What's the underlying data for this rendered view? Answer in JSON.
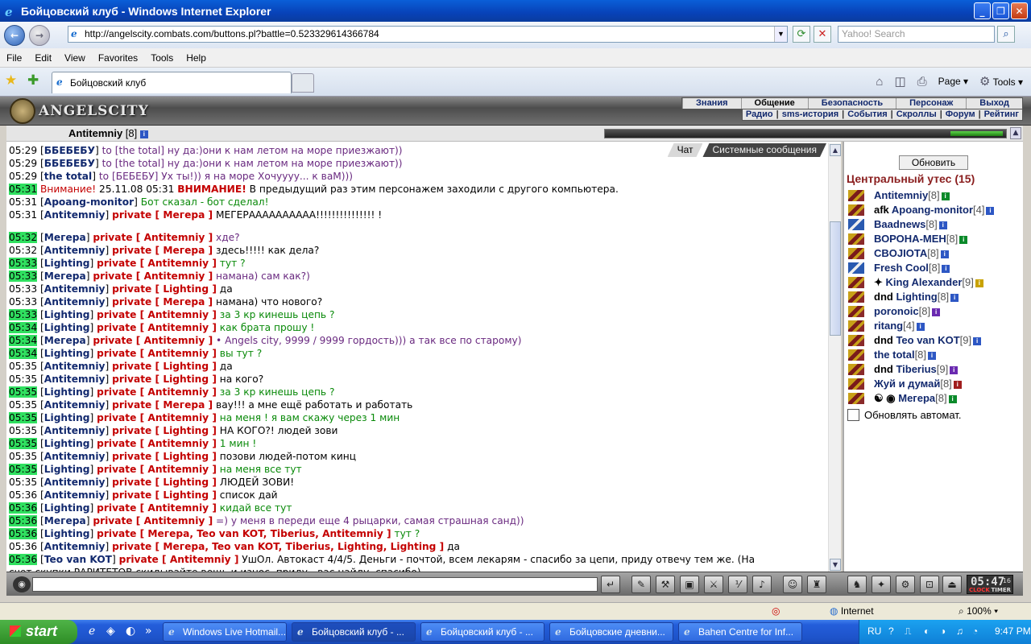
{
  "window": {
    "title": "Бойцовский клуб - Windows Internet Explorer"
  },
  "address": {
    "url": "http://angelscity.combats.com/buttons.pl?battle=0.523329614366784",
    "search_placeholder": "Yahoo! Search"
  },
  "menu": [
    "File",
    "Edit",
    "View",
    "Favorites",
    "Tools",
    "Help"
  ],
  "tab": {
    "title": "Бойцовский клуб"
  },
  "commands": {
    "page": "Page",
    "tools": "Tools"
  },
  "game": {
    "logo": "ANGELSCITY",
    "nav_top": [
      "Знания",
      "Общение",
      "Безопасность",
      "Персонаж",
      "Выход"
    ],
    "nav_bottom": [
      "Радио",
      "sms-история",
      "События",
      "Скроллы",
      "Форум",
      "Рейтинг"
    ],
    "user": {
      "name": "Antitemniy",
      "level": "[8]"
    },
    "hp_fraction": 0.13
  },
  "chat": {
    "tabs": [
      "Чат",
      "Системные сообщения"
    ],
    "lines": [
      {
        "time": "05:29",
        "hl": false,
        "name": "ББЕБЕБУ",
        "pre": " to [the total] ",
        "priv": "",
        "msg": "ну да:)они к нам летом на море приезжают))",
        "color": "purple"
      },
      {
        "time": "05:29",
        "hl": false,
        "name": "ББЕБЕБУ",
        "pre": " to [the total] ",
        "priv": "",
        "msg": "ну да:)они к нам летом на море приезжают))",
        "color": "purple"
      },
      {
        "time": "05:29",
        "hl": false,
        "name": "the total",
        "pre": " to [БЕБЕБУ] ",
        "priv": "",
        "msg": "Ух ты!)) я на море Хочуууу... к ваМ)))",
        "color": "purple"
      },
      {
        "time": "05:31",
        "hl": true,
        "name": "",
        "pre": "",
        "priv": "",
        "msg": "",
        "color": "black",
        "warning": {
          "label": "Внимание!",
          "date": " 25.11.08 05:31 ",
          "bold": "ВНИМАНИЕ!",
          "text": " В предыдущий раз этим персонажем заходили с другого компьютера."
        }
      },
      {
        "time": "05:31",
        "hl": false,
        "name": "Apoang-monitor",
        "pre": " ",
        "priv": "",
        "msg": "Бот сказал - бот сделал!",
        "color": "green"
      },
      {
        "time": "05:31",
        "hl": false,
        "name": "Antitemniy",
        "pre": " ",
        "priv": "private [ Мегера ]",
        "msg": " МЕГЕРАААААААААА!!!!!!!!!!!!!!! !",
        "color": "black"
      },
      {
        "time": "05:32",
        "hl": true,
        "gap": true,
        "name": "Мегера",
        "pre": " ",
        "priv": "private [ Antitemniy ]",
        "msg": "        хде?",
        "color": "purple"
      },
      {
        "time": "05:32",
        "hl": false,
        "name": "Antitemniy",
        "pre": " ",
        "priv": "private [ Мегера ]",
        "msg": " здесь!!!!! как дела?",
        "color": "black"
      },
      {
        "time": "05:33",
        "hl": true,
        "name": "Lighting",
        "pre": " ",
        "priv": "private [ Antitemniy ]",
        "msg": " тут ?",
        "color": "green"
      },
      {
        "time": "05:33",
        "hl": true,
        "name": "Мегера",
        "pre": " ",
        "priv": "private [ Antitemniy ]",
        "msg": " намана) сам как?)",
        "color": "purple"
      },
      {
        "time": "05:33",
        "hl": false,
        "name": "Antitemniy",
        "pre": " ",
        "priv": "private [ Lighting ]",
        "msg": " да",
        "color": "black"
      },
      {
        "time": "05:33",
        "hl": false,
        "name": "Antitemniy",
        "pre": " ",
        "priv": "private [ Мегера ]",
        "msg": " намана) что нового?",
        "color": "black"
      },
      {
        "time": "05:33",
        "hl": true,
        "name": "Lighting",
        "pre": " ",
        "priv": "private [ Antitemniy ]",
        "msg": " за 3 кр кинешь цепь ?",
        "color": "green"
      },
      {
        "time": "05:34",
        "hl": true,
        "name": "Lighting",
        "pre": " ",
        "priv": "private [ Antitemniy ]",
        "msg": " как брата прошу !",
        "color": "green"
      },
      {
        "time": "05:34",
        "hl": true,
        "name": "Мегера",
        "pre": " ",
        "priv": "private [ Antitemniy ]",
        "msg": " • Angels city, 9999 / 9999 гордость))) а так все по старому)",
        "color": "purple"
      },
      {
        "time": "05:34",
        "hl": true,
        "name": "Lighting",
        "pre": " ",
        "priv": "private [ Antitemniy ]",
        "msg": " вы тут ?",
        "color": "green"
      },
      {
        "time": "05:35",
        "hl": false,
        "name": "Antitemniy",
        "pre": " ",
        "priv": "private [ Lighting ]",
        "msg": " да",
        "color": "black"
      },
      {
        "time": "05:35",
        "hl": false,
        "name": "Antitemniy",
        "pre": " ",
        "priv": "private [ Lighting ]",
        "msg": " на кого?",
        "color": "black"
      },
      {
        "time": "05:35",
        "hl": true,
        "name": "Lighting",
        "pre": " ",
        "priv": "private [ Antitemniy ]",
        "msg": " за 3 кр кинешь цепь ?",
        "color": "green"
      },
      {
        "time": "05:35",
        "hl": false,
        "name": "Antitemniy",
        "pre": " ",
        "priv": "private [ Мегера ]",
        "msg": " вау!!! а мне ещё работать и работать",
        "color": "black"
      },
      {
        "time": "05:35",
        "hl": true,
        "name": "Lighting",
        "pre": " ",
        "priv": "private [ Antitemniy ]",
        "msg": " на меня ! я вам скажу через 1 мин",
        "color": "green"
      },
      {
        "time": "05:35",
        "hl": false,
        "name": "Antitemniy",
        "pre": " ",
        "priv": "private [ Lighting ]",
        "msg": " НА КОГО?! людей зови",
        "color": "black"
      },
      {
        "time": "05:35",
        "hl": true,
        "name": "Lighting",
        "pre": " ",
        "priv": "private [ Antitemniy ]",
        "msg": " 1 мин !",
        "color": "green"
      },
      {
        "time": "05:35",
        "hl": false,
        "name": "Antitemniy",
        "pre": " ",
        "priv": "private [ Lighting ]",
        "msg": " позови людей-потом кинц",
        "color": "black"
      },
      {
        "time": "05:35",
        "hl": true,
        "name": "Lighting",
        "pre": " ",
        "priv": "private [ Antitemniy ]",
        "msg": " на меня все тут",
        "color": "green"
      },
      {
        "time": "05:35",
        "hl": false,
        "name": "Antitemniy",
        "pre": " ",
        "priv": "private [ Lighting ]",
        "msg": " ЛЮДЕЙ ЗОВИ!",
        "color": "black"
      },
      {
        "time": "05:36",
        "hl": false,
        "name": "Antitemniy",
        "pre": " ",
        "priv": "private [ Lighting ]",
        "msg": " список дай",
        "color": "black"
      },
      {
        "time": "05:36",
        "hl": true,
        "name": "Lighting",
        "pre": " ",
        "priv": "private [ Antitemniy ]",
        "msg": " кидай все тут",
        "color": "green"
      },
      {
        "time": "05:36",
        "hl": true,
        "name": "Мегера",
        "pre": " ",
        "priv": "private [ Antitemniy ]",
        "msg": " =) у меня в переди еще 4 рыцарки, самая страшная санд))",
        "color": "purple"
      },
      {
        "time": "05:36",
        "hl": true,
        "name": "Lighting",
        "pre": " ",
        "priv": "private [ Мегера, Teo van KOT, Tiberius, Antitemniy ]",
        "msg": " тут ?",
        "color": "green"
      },
      {
        "time": "05:36",
        "hl": false,
        "name": "Antitemniy",
        "pre": " ",
        "priv": "private [ Мегера, Teo van KOT, Tiberius, Lighting, Lighting ]",
        "msg": " да",
        "color": "black"
      },
      {
        "time": "05:36",
        "hl": true,
        "name": "Teo van KOT",
        "pre": " ",
        "priv": "private [ Antitemniy ]",
        "msg": " УшОл. Автокаст 4/4/5. Деньги - почтой, всем лекарям - спасибо за цепи, приду отвечу тем же. (На",
        "color": "black"
      },
      {
        "time": "",
        "hl": false,
        "name": "",
        "pre": "",
        "priv": "",
        "msg": "счет скупки РАРИТЕТОВ скидывайте вещь и износ, приду - вас найду, спасибо)",
        "color": "black"
      }
    ]
  },
  "sidebar": {
    "refresh": "Обновить",
    "location": "Центральный утес (15)",
    "players": [
      {
        "prefix": "",
        "name": "Antitemniy",
        "level": "[8]",
        "badge": "g",
        "flag": "r"
      },
      {
        "prefix": "afk ",
        "name": "Apoang-monitor",
        "level": "[4]",
        "badge": "b",
        "flag": "r"
      },
      {
        "prefix": "",
        "name": "Baadnews",
        "level": "[8]",
        "badge": "b",
        "flag": "b"
      },
      {
        "prefix": "",
        "name": "ВОРОНА-МЕН",
        "level": "[8]",
        "badge": "g",
        "flag": "r"
      },
      {
        "prefix": "",
        "name": "CBOJIOTA",
        "level": "[8]",
        "badge": "b",
        "flag": "r"
      },
      {
        "prefix": "",
        "name": "Fresh Cool",
        "level": "[8]",
        "badge": "b",
        "flag": "b"
      },
      {
        "prefix": "✦ ",
        "name": "King Alexander",
        "level": "[9]",
        "badge": "y",
        "flag": "r"
      },
      {
        "prefix": "dnd ",
        "name": "Lighting",
        "level": "[8]",
        "badge": "b",
        "flag": "r"
      },
      {
        "prefix": "",
        "name": "poronoic",
        "level": "[8]",
        "badge": "p",
        "flag": "r"
      },
      {
        "prefix": "",
        "name": "ritang",
        "level": "[4]",
        "badge": "b",
        "flag": "r"
      },
      {
        "prefix": "dnd ",
        "name": "Teo van KOT",
        "level": "[9]",
        "badge": "b",
        "flag": "r"
      },
      {
        "prefix": "",
        "name": "the total",
        "level": "[8]",
        "badge": "b",
        "flag": "r"
      },
      {
        "prefix": "dnd ",
        "name": "Tiberius",
        "level": "[9]",
        "badge": "p",
        "flag": "r"
      },
      {
        "prefix": "",
        "name": "Жуй и думай",
        "level": "[8]",
        "badge": "r",
        "flag": "r"
      },
      {
        "prefix": "☯ ◉ ",
        "name": "Мегера",
        "level": "[8]",
        "badge": "g",
        "flag": "r"
      }
    ],
    "auto_refresh": "Обновлять автомат."
  },
  "clock": {
    "time": "05:47",
    "sec": "16",
    "label1": "CLOCK",
    "label2": "TIMER"
  },
  "status": {
    "zone": "Internet",
    "zoom": "100%"
  },
  "taskbar": {
    "start": "start",
    "tasks": [
      "Windows Live Hotmail...",
      "Бойцовский клуб - ...",
      "Бойцовский клуб - ...",
      "Бойцовские дневни...",
      "Bahen Centre for Inf..."
    ],
    "lang": "RU",
    "time": "9:47 PM"
  }
}
